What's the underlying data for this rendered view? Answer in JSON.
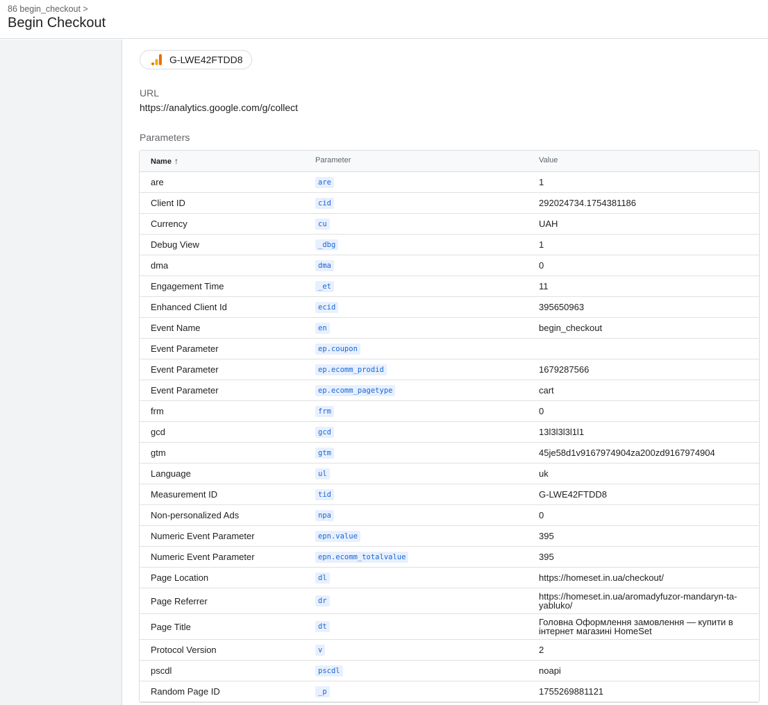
{
  "header": {
    "breadcrumb": "86 begin_checkout >",
    "title": "Begin Checkout"
  },
  "tag": {
    "id": "G-LWE42FTDD8",
    "icon": "google-analytics-icon",
    "colors": {
      "bar_dark": "#e37400",
      "bar_light": "#f9ab00"
    }
  },
  "url_section": {
    "label": "URL",
    "value": "https://analytics.google.com/g/collect"
  },
  "parameters": {
    "label": "Parameters",
    "headers": {
      "name": "Name",
      "parameter": "Parameter",
      "value": "Value"
    },
    "sort_icon": "arrow-up-icon",
    "rows": [
      {
        "name": "are",
        "param": "are",
        "value": "1"
      },
      {
        "name": "Client ID",
        "param": "cid",
        "value": "292024734.1754381186"
      },
      {
        "name": "Currency",
        "param": "cu",
        "value": "UAH"
      },
      {
        "name": "Debug View",
        "param": "_dbg",
        "value": "1"
      },
      {
        "name": "dma",
        "param": "dma",
        "value": "0"
      },
      {
        "name": "Engagement Time",
        "param": "_et",
        "value": "11"
      },
      {
        "name": "Enhanced Client Id",
        "param": "ecid",
        "value": "395650963"
      },
      {
        "name": "Event Name",
        "param": "en",
        "value": "begin_checkout"
      },
      {
        "name": "Event Parameter",
        "param": "ep.coupon",
        "value": ""
      },
      {
        "name": "Event Parameter",
        "param": "ep.ecomm_prodid",
        "value": "1679287566"
      },
      {
        "name": "Event Parameter",
        "param": "ep.ecomm_pagetype",
        "value": "cart"
      },
      {
        "name": "frm",
        "param": "frm",
        "value": "0"
      },
      {
        "name": "gcd",
        "param": "gcd",
        "value": "13l3l3l3l1l1"
      },
      {
        "name": "gtm",
        "param": "gtm",
        "value": "45je58d1v9167974904za200zd9167974904"
      },
      {
        "name": "Language",
        "param": "ul",
        "value": "uk"
      },
      {
        "name": "Measurement ID",
        "param": "tid",
        "value": "G-LWE42FTDD8"
      },
      {
        "name": "Non-personalized Ads",
        "param": "npa",
        "value": "0"
      },
      {
        "name": "Numeric Event Parameter",
        "param": "epn.value",
        "value": "395"
      },
      {
        "name": "Numeric Event Parameter",
        "param": "epn.ecomm_totalvalue",
        "value": "395"
      },
      {
        "name": "Page Location",
        "param": "dl",
        "value": "https://homeset.in.ua/checkout/"
      },
      {
        "name": "Page Referrer",
        "param": "dr",
        "value": "https://homeset.in.ua/aromadyfuzor-mandaryn-ta-yabluko/"
      },
      {
        "name": "Page Title",
        "param": "dt",
        "value": "Головна Оформлення замовлення — купити в інтернет магазині HomeSet"
      },
      {
        "name": "Protocol Version",
        "param": "v",
        "value": "2"
      },
      {
        "name": "pscdl",
        "param": "pscdl",
        "value": "noapi"
      },
      {
        "name": "Random Page ID",
        "param": "_p",
        "value": "1755269881121"
      }
    ]
  }
}
